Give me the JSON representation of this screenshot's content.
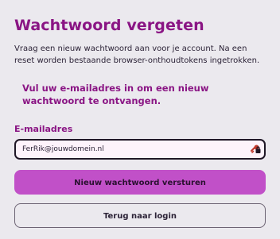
{
  "page": {
    "title": "Wachtwoord vergeten",
    "intro": "Vraag een nieuw wachtwoord aan voor je account. Na een reset worden bestaande browser-onthoudtokens ingetrokken.",
    "instruction": "Vul uw e-mailadres in om een nieuw wachtwoord te ontvangen."
  },
  "form": {
    "email_label": "E-mailadres",
    "email_value": "FerRik@jouwdomein.nl",
    "password_manager_icon": "key-lock-icon",
    "submit_label": "Nieuw wachtwoord versturen",
    "back_label": "Terug naar login"
  },
  "colors": {
    "accent": "#8a1584",
    "primary_button": "#c150c8",
    "background": "#ebe9ee"
  }
}
